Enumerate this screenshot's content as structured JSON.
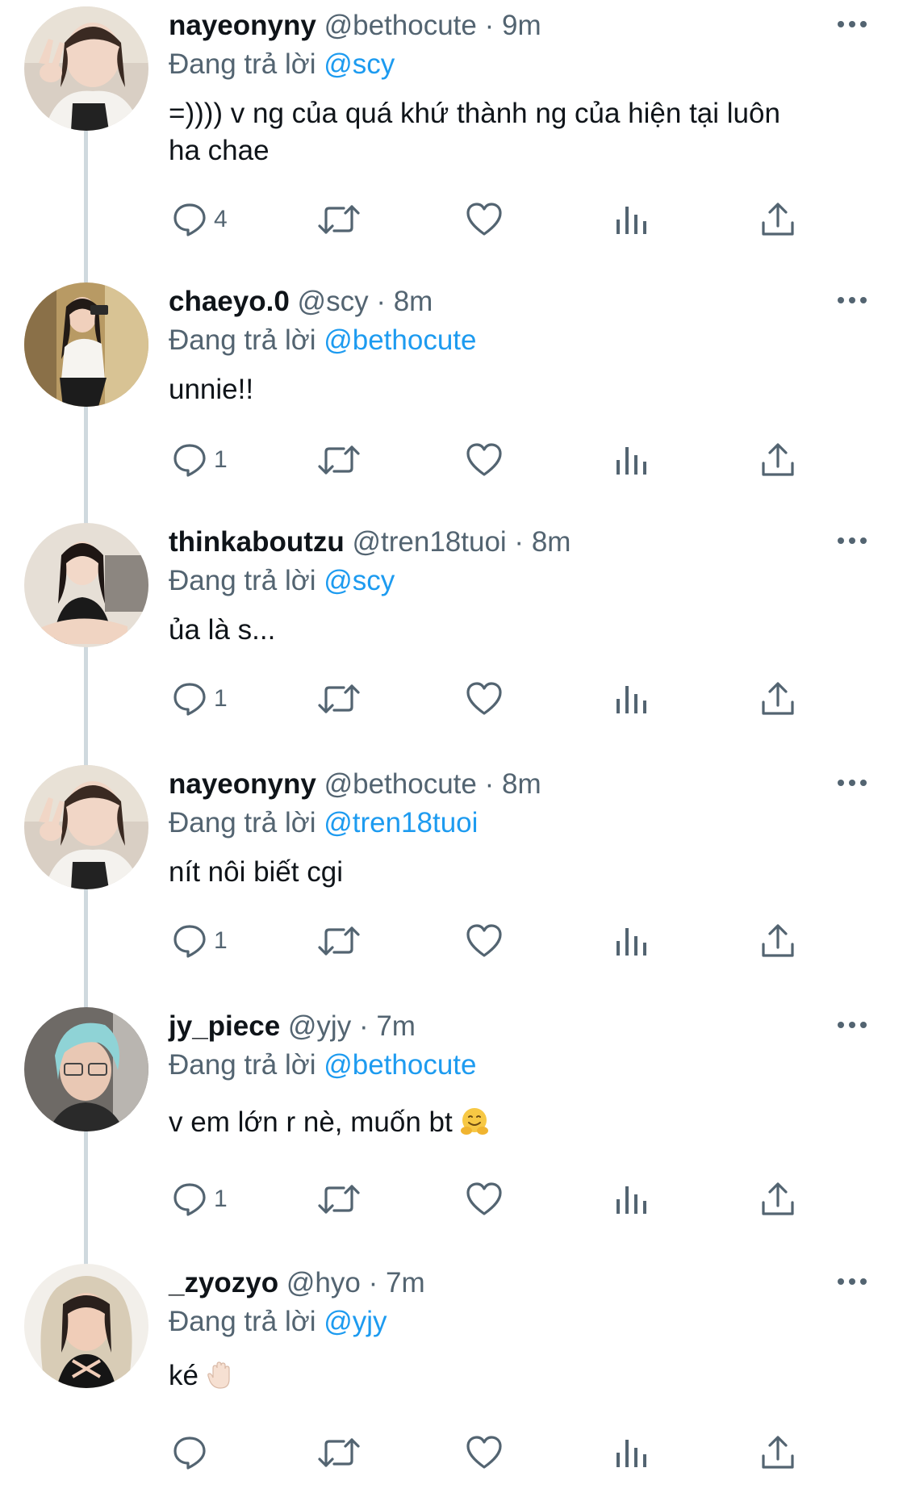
{
  "tweets": [
    {
      "name": "nayeonyny",
      "handle": "@bethocute",
      "dot": "·",
      "time": "9m",
      "reply_prefix": "Đang trả lời",
      "reply_to": "@scy",
      "text_lines": [
        "=)))) v ng của quá khứ thành ng của hiện tại luôn",
        "ha chae"
      ],
      "reply_count": "4",
      "avatar": "avatar-peace-sign"
    },
    {
      "name": "chaeyo.0",
      "handle": "@scy",
      "dot": "·",
      "time": "8m",
      "reply_prefix": "Đang trả lời",
      "reply_to": "@bethocute",
      "text_lines": [
        "unnie!!"
      ],
      "reply_count": "1",
      "avatar": "avatar-mirror-selfie"
    },
    {
      "name": "thinkaboutzu",
      "handle": "@tren18tuoi",
      "dot": "·",
      "time": "8m",
      "reply_prefix": "Đang trả lời",
      "reply_to": "@scy",
      "text_lines": [
        "ủa là s..."
      ],
      "reply_count": "1",
      "avatar": "avatar-sitting-portrait"
    },
    {
      "name": "nayeonyny",
      "handle": "@bethocute",
      "dot": "·",
      "time": "8m",
      "reply_prefix": "Đang trả lời",
      "reply_to": "@tren18tuoi",
      "text_lines": [
        "nít nôi biết cgi"
      ],
      "reply_count": "1",
      "avatar": "avatar-peace-sign"
    },
    {
      "name": "jy_piece",
      "handle": "@yjy",
      "dot": "·",
      "time": "7m",
      "reply_prefix": "Đang trả lời",
      "reply_to": "@bethocute",
      "text_lines": [
        "v em lớn r nè, muốn bt"
      ],
      "emoji": "hugging-face-emoji",
      "reply_count": "1",
      "avatar": "avatar-blue-hair"
    },
    {
      "name": "_zyozyo",
      "handle": "@hyo",
      "dot": "·",
      "time": "7m",
      "reply_prefix": "Đang trả lời",
      "reply_to": "@yjy",
      "text_lines": [
        "ké"
      ],
      "emoji": "raised-hand-emoji",
      "reply_count": "",
      "avatar": "avatar-hood-wink"
    }
  ],
  "icons": {
    "reply": "reply-bubble-icon",
    "retweet": "retweet-icon",
    "like": "heart-icon",
    "views": "views-bar-icon",
    "share": "share-icon",
    "more": "more-dots-icon"
  },
  "colors": {
    "text": "#0f1419",
    "secondary": "#536471",
    "mention": "#1d9bf0",
    "thread_line": "#cfd9de",
    "background": "#ffffff"
  }
}
